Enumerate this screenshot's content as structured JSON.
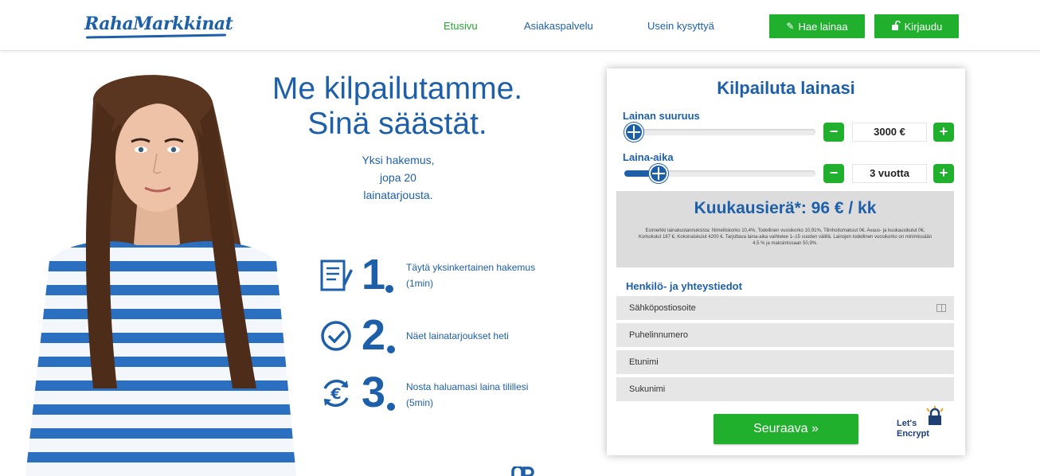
{
  "header": {
    "logo": "RahaMarkkinat",
    "nav": {
      "home": "Etusivu",
      "support": "Asiakaspalvelu",
      "faq": "Usein kysyttyä",
      "apply": "Hae lainaa",
      "login": "Kirjaudu"
    }
  },
  "hero": {
    "headline_line1": "Me kilpailutamme.",
    "headline_line2": "Sinä säästät.",
    "sub_line1": "Yksi hakemus,",
    "sub_line2": "jopa 20",
    "sub_line3": "lainatarjousta."
  },
  "steps": [
    {
      "number": "1",
      "line1": "Täytä yksinkertainen hakemus",
      "line2": "(1min)",
      "icon": "form-icon"
    },
    {
      "number": "2",
      "line1": "Näet lainatarjoukset heti",
      "line2": "",
      "icon": "checkmark-icon"
    },
    {
      "number": "3",
      "line1": "Nosta haluamasi laina tilillesi",
      "line2": "(5min)",
      "icon": "euro-icon"
    }
  ],
  "form": {
    "title": "Kilpailuta lainasi",
    "amount": {
      "label": "Lainan suuruus",
      "value": "3000 €",
      "level": 0.05
    },
    "term": {
      "label": "Laina-aika",
      "value": "3 vuotta",
      "level": 0.18
    },
    "minus": "−",
    "plus": "+",
    "monthly": {
      "title": "Kuukausierä*: 96 € / kk",
      "note": "Esimerkki lainakustannuksista: Nimelliskorko 10,4%, Todellinen vuosikorko 10,91%, Tilinhoitomaksut 0€. Avaus- ja kuukausikulut 0€, Korkokulut 187 €, Kokonaiskulut 4200 €. Tarjottava laina-aika vaihtelee 1–15 vuoden välillä. Lainojen todellinen vuosikorko on minimissään 4,5 % ja maksimissaan 50,9%."
    },
    "contact_label": "Henkilö- ja yhteystiedot",
    "fields": {
      "email": "Sähköpostiosoite",
      "phone": "Puhelinnumero",
      "first_name": "Etunimi",
      "last_name": "Sukunimi"
    },
    "next_button": "Seuraava »",
    "badge_line1": "Let's",
    "badge_line2": "Encrypt"
  },
  "colors": {
    "brand_blue": "#1d5fa8",
    "green": "#21b02e"
  }
}
